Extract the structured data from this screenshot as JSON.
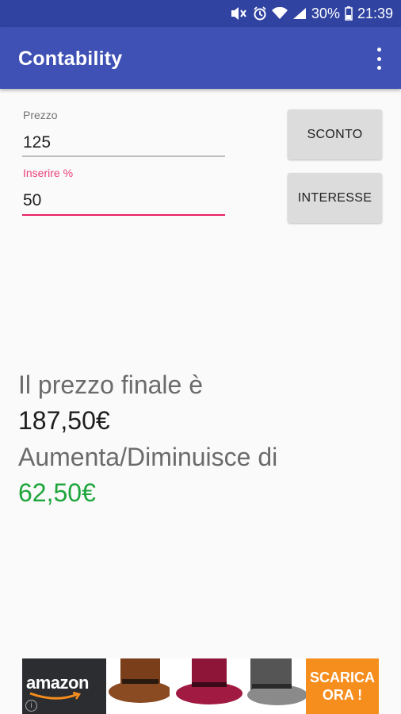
{
  "status_bar": {
    "battery_percent": "30%",
    "time": "21:39",
    "icons": [
      "mute-icon",
      "alarm-icon",
      "wifi-icon",
      "signal-icon",
      "battery-icon"
    ]
  },
  "app_bar": {
    "title": "Contability",
    "overflow_icon": "more-vert-icon"
  },
  "form": {
    "price_label": "Prezzo",
    "price_value": "125",
    "percent_label": "Inserire %",
    "percent_value": "50"
  },
  "buttons": {
    "discount": "SCONTO",
    "interest": "INTERESSE"
  },
  "result": {
    "final_price_label": "Il prezzo finale è",
    "final_price_value": "187,50€",
    "change_label": "Aumenta/Diminuisce di",
    "change_value": "62,50€"
  },
  "ad": {
    "brand": "amazon",
    "cta_line1": "SCARICA",
    "cta_line2": "ORA !",
    "info_icon": "info-icon"
  },
  "colors": {
    "status_bar": "#3043a1",
    "app_bar": "#3f51b5",
    "accent": "#e91e63",
    "result_green": "#1ea53b",
    "ad_cta": "#f68e1e"
  }
}
